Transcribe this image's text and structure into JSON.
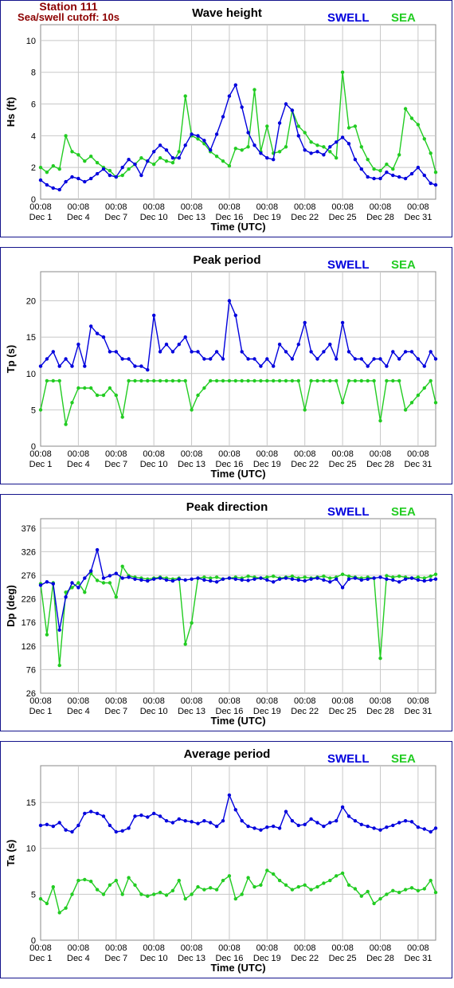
{
  "station": {
    "line1": "Station 111",
    "line2": "Sea/swell cutoff: 10s"
  },
  "colors": {
    "swell": "#0000dd",
    "sea": "#22cc22",
    "frame": "#14148c",
    "station": "#8c0000"
  },
  "legend": {
    "swell": "SWELL",
    "sea": "SEA"
  },
  "x_axis": {
    "label": "Time (UTC)",
    "ticks": [
      {
        "time": "00:08",
        "date": "Dec 1"
      },
      {
        "time": "00:08",
        "date": "Dec 4"
      },
      {
        "time": "00:08",
        "date": "Dec 7"
      },
      {
        "time": "00:08",
        "date": "Dec 10"
      },
      {
        "time": "00:08",
        "date": "Dec 13"
      },
      {
        "time": "00:08",
        "date": "Dec 16"
      },
      {
        "time": "00:08",
        "date": "Dec 19"
      },
      {
        "time": "00:08",
        "date": "Dec 22"
      },
      {
        "time": "00:08",
        "date": "Dec 25"
      },
      {
        "time": "00:08",
        "date": "Dec 28"
      },
      {
        "time": "00:08",
        "date": "Dec 31"
      }
    ]
  },
  "chart_data": [
    {
      "type": "line",
      "title": "Wave height",
      "ylabel": "Hs (ft)",
      "xlabel": "Time (UTC)",
      "xlim": [
        1,
        32.4
      ],
      "ylim": [
        0,
        11
      ],
      "yticks": [
        0,
        2,
        4,
        6,
        8,
        10
      ],
      "grid": true,
      "legend": "top-right",
      "x": [
        1,
        1.5,
        2,
        2.5,
        3,
        3.5,
        4,
        4.5,
        5,
        5.5,
        6,
        6.5,
        7,
        7.5,
        8,
        8.5,
        9,
        9.5,
        10,
        10.5,
        11,
        11.5,
        12,
        12.5,
        13,
        13.5,
        14,
        14.5,
        15,
        15.5,
        16,
        16.5,
        17,
        17.5,
        18,
        18.5,
        19,
        19.5,
        20,
        20.5,
        21,
        21.5,
        22,
        22.5,
        23,
        23.5,
        24,
        24.5,
        25,
        25.5,
        26,
        26.5,
        27,
        27.5,
        28,
        28.5,
        29,
        29.5,
        30,
        30.5,
        31,
        31.5,
        32,
        32.4
      ],
      "series": [
        {
          "name": "SWELL",
          "values": [
            1.2,
            0.9,
            0.7,
            0.6,
            1.1,
            1.4,
            1.3,
            1.1,
            1.3,
            1.6,
            1.9,
            1.5,
            1.4,
            2.0,
            2.5,
            2.2,
            1.5,
            2.4,
            3.0,
            3.4,
            3.1,
            2.6,
            2.6,
            3.4,
            4.1,
            4.0,
            3.7,
            3.1,
            4.1,
            5.2,
            6.5,
            7.2,
            5.8,
            4.2,
            3.4,
            2.9,
            2.6,
            2.5,
            4.8,
            6.0,
            5.6,
            4.0,
            3.1,
            2.9,
            3.0,
            2.8,
            3.3,
            3.6,
            3.9,
            3.5,
            2.5,
            1.9,
            1.4,
            1.3,
            1.3,
            1.7,
            1.5,
            1.4,
            1.3,
            1.6,
            2.0,
            1.5,
            1.0,
            0.9
          ]
        },
        {
          "name": "SEA",
          "values": [
            2.0,
            1.7,
            2.1,
            1.9,
            4.0,
            3.0,
            2.8,
            2.4,
            2.7,
            2.3,
            2.0,
            1.8,
            1.4,
            1.5,
            1.9,
            2.2,
            2.6,
            2.4,
            2.2,
            2.6,
            2.4,
            2.3,
            3.0,
            6.5,
            4.0,
            3.8,
            3.5,
            3.0,
            2.7,
            2.4,
            2.1,
            3.2,
            3.1,
            3.3,
            6.9,
            3.0,
            4.6,
            2.9,
            3.0,
            3.3,
            5.6,
            4.6,
            4.2,
            3.6,
            3.4,
            3.3,
            3.0,
            2.6,
            8.0,
            4.5,
            4.6,
            3.3,
            2.5,
            1.9,
            1.8,
            2.2,
            1.9,
            2.8,
            5.7,
            5.1,
            4.7,
            3.8,
            2.9,
            1.7
          ]
        }
      ]
    },
    {
      "type": "line",
      "title": "Peak period",
      "ylabel": "Tp (s)",
      "xlabel": "Time (UTC)",
      "xlim": [
        1,
        32.4
      ],
      "ylim": [
        0,
        24
      ],
      "yticks": [
        0,
        5,
        10,
        15,
        20
      ],
      "grid": true,
      "legend": "top-right",
      "x": [
        1,
        1.5,
        2,
        2.5,
        3,
        3.5,
        4,
        4.5,
        5,
        5.5,
        6,
        6.5,
        7,
        7.5,
        8,
        8.5,
        9,
        9.5,
        10,
        10.5,
        11,
        11.5,
        12,
        12.5,
        13,
        13.5,
        14,
        14.5,
        15,
        15.5,
        16,
        16.5,
        17,
        17.5,
        18,
        18.5,
        19,
        19.5,
        20,
        20.5,
        21,
        21.5,
        22,
        22.5,
        23,
        23.5,
        24,
        24.5,
        25,
        25.5,
        26,
        26.5,
        27,
        27.5,
        28,
        28.5,
        29,
        29.5,
        30,
        30.5,
        31,
        31.5,
        32,
        32.4
      ],
      "series": [
        {
          "name": "SWELL",
          "values": [
            11,
            12,
            13,
            11,
            12,
            11,
            14,
            11,
            16.5,
            15.5,
            15,
            13,
            13,
            12,
            12,
            11,
            11,
            10.5,
            18,
            13,
            14,
            13,
            14,
            15,
            13,
            13,
            12,
            12,
            13,
            12,
            20,
            18,
            13,
            12,
            12,
            11,
            12,
            11,
            14,
            13,
            12,
            14,
            17,
            13,
            12,
            13,
            14,
            12,
            17,
            13,
            12,
            12,
            11,
            12,
            12,
            11,
            13,
            12,
            13,
            13,
            12,
            11,
            13,
            12
          ]
        },
        {
          "name": "SEA",
          "values": [
            5,
            9,
            9,
            9,
            3,
            6,
            8,
            8,
            8,
            7,
            7,
            8,
            7,
            4,
            9,
            9,
            9,
            9,
            9,
            9,
            9,
            9,
            9,
            9,
            5,
            7,
            8,
            9,
            9,
            9,
            9,
            9,
            9,
            9,
            9,
            9,
            9,
            9,
            9,
            9,
            9,
            9,
            5,
            9,
            9,
            9,
            9,
            9,
            6,
            9,
            9,
            9,
            9,
            9,
            3.5,
            9,
            9,
            9,
            5,
            6,
            7,
            8,
            9,
            6
          ]
        }
      ]
    },
    {
      "type": "line",
      "title": "Peak direction",
      "ylabel": "Dp (deg)",
      "xlabel": "Time (UTC)",
      "xlim": [
        1,
        32.4
      ],
      "ylim": [
        26,
        396
      ],
      "yticks": [
        26,
        76,
        126,
        176,
        226,
        276,
        326,
        376
      ],
      "grid": true,
      "legend": "top-right",
      "x": [
        1,
        1.5,
        2,
        2.5,
        3,
        3.5,
        4,
        4.5,
        5,
        5.5,
        6,
        6.5,
        7,
        7.5,
        8,
        8.5,
        9,
        9.5,
        10,
        10.5,
        11,
        11.5,
        12,
        12.5,
        13,
        13.5,
        14,
        14.5,
        15,
        15.5,
        16,
        16.5,
        17,
        17.5,
        18,
        18.5,
        19,
        19.5,
        20,
        20.5,
        21,
        21.5,
        22,
        22.5,
        23,
        23.5,
        24,
        24.5,
        25,
        25.5,
        26,
        26.5,
        27,
        27.5,
        28,
        28.5,
        29,
        29.5,
        30,
        30.5,
        31,
        31.5,
        32,
        32.4
      ],
      "series": [
        {
          "name": "SWELL",
          "values": [
            255,
            262,
            258,
            160,
            230,
            260,
            250,
            270,
            285,
            330,
            270,
            275,
            280,
            270,
            272,
            268,
            266,
            264,
            268,
            270,
            266,
            264,
            268,
            266,
            268,
            270,
            266,
            264,
            262,
            268,
            270,
            268,
            266,
            265,
            268,
            270,
            266,
            262,
            268,
            270,
            268,
            266,
            264,
            268,
            270,
            266,
            262,
            268,
            250,
            268,
            270,
            266,
            268,
            270,
            272,
            268,
            266,
            262,
            268,
            270,
            266,
            264,
            266,
            268
          ]
        },
        {
          "name": "SEA",
          "values": [
            258,
            150,
            260,
            85,
            240,
            250,
            260,
            240,
            280,
            265,
            260,
            260,
            230,
            295,
            275,
            272,
            270,
            268,
            270,
            272,
            270,
            268,
            270,
            130,
            175,
            270,
            272,
            270,
            272,
            268,
            270,
            272,
            270,
            274,
            272,
            270,
            272,
            274,
            270,
            272,
            274,
            270,
            272,
            270,
            272,
            274,
            270,
            272,
            278,
            274,
            272,
            270,
            272,
            270,
            100,
            275,
            272,
            274,
            272,
            270,
            272,
            270,
            274,
            278
          ]
        }
      ]
    },
    {
      "type": "line",
      "title": "Average period",
      "ylabel": "Ta (s)",
      "xlabel": "Time (UTC)",
      "xlim": [
        1,
        32.4
      ],
      "ylim": [
        0,
        19
      ],
      "yticks": [
        0,
        5,
        10,
        15
      ],
      "grid": true,
      "legend": "top-right",
      "x": [
        1,
        1.5,
        2,
        2.5,
        3,
        3.5,
        4,
        4.5,
        5,
        5.5,
        6,
        6.5,
        7,
        7.5,
        8,
        8.5,
        9,
        9.5,
        10,
        10.5,
        11,
        11.5,
        12,
        12.5,
        13,
        13.5,
        14,
        14.5,
        15,
        15.5,
        16,
        16.5,
        17,
        17.5,
        18,
        18.5,
        19,
        19.5,
        20,
        20.5,
        21,
        21.5,
        22,
        22.5,
        23,
        23.5,
        24,
        24.5,
        25,
        25.5,
        26,
        26.5,
        27,
        27.5,
        28,
        28.5,
        29,
        29.5,
        30,
        30.5,
        31,
        31.5,
        32,
        32.4
      ],
      "series": [
        {
          "name": "SWELL",
          "values": [
            12.5,
            12.6,
            12.4,
            12.8,
            12.0,
            11.8,
            12.5,
            13.8,
            14.0,
            13.8,
            13.5,
            12.5,
            11.8,
            11.9,
            12.2,
            13.5,
            13.6,
            13.4,
            13.8,
            13.5,
            13.0,
            12.8,
            13.2,
            13.0,
            12.9,
            12.7,
            13.0,
            12.8,
            12.4,
            13.0,
            15.8,
            14.2,
            13.0,
            12.4,
            12.2,
            12.0,
            12.3,
            12.4,
            12.2,
            14.0,
            13.0,
            12.5,
            12.6,
            13.2,
            12.8,
            12.4,
            12.8,
            13.0,
            14.5,
            13.5,
            13.0,
            12.6,
            12.4,
            12.2,
            12.0,
            12.3,
            12.5,
            12.8,
            13.0,
            12.9,
            12.3,
            12.1,
            11.8,
            12.2
          ]
        },
        {
          "name": "SEA",
          "values": [
            4.5,
            4.0,
            5.8,
            3.0,
            3.5,
            5.0,
            6.5,
            6.6,
            6.4,
            5.5,
            5.0,
            6.0,
            6.5,
            5.0,
            6.8,
            6.0,
            5.0,
            4.8,
            5.0,
            5.2,
            4.9,
            5.4,
            6.5,
            4.5,
            5.0,
            5.8,
            5.5,
            5.7,
            5.5,
            6.5,
            7.0,
            4.5,
            5.0,
            6.8,
            5.8,
            6.0,
            7.6,
            7.2,
            6.5,
            6.0,
            5.5,
            5.8,
            6.0,
            5.5,
            5.8,
            6.2,
            6.5,
            7.0,
            7.3,
            6.0,
            5.6,
            4.8,
            5.3,
            4.0,
            4.5,
            5.0,
            5.4,
            5.2,
            5.5,
            5.7,
            5.4,
            5.6,
            6.5,
            5.2
          ]
        }
      ]
    }
  ]
}
